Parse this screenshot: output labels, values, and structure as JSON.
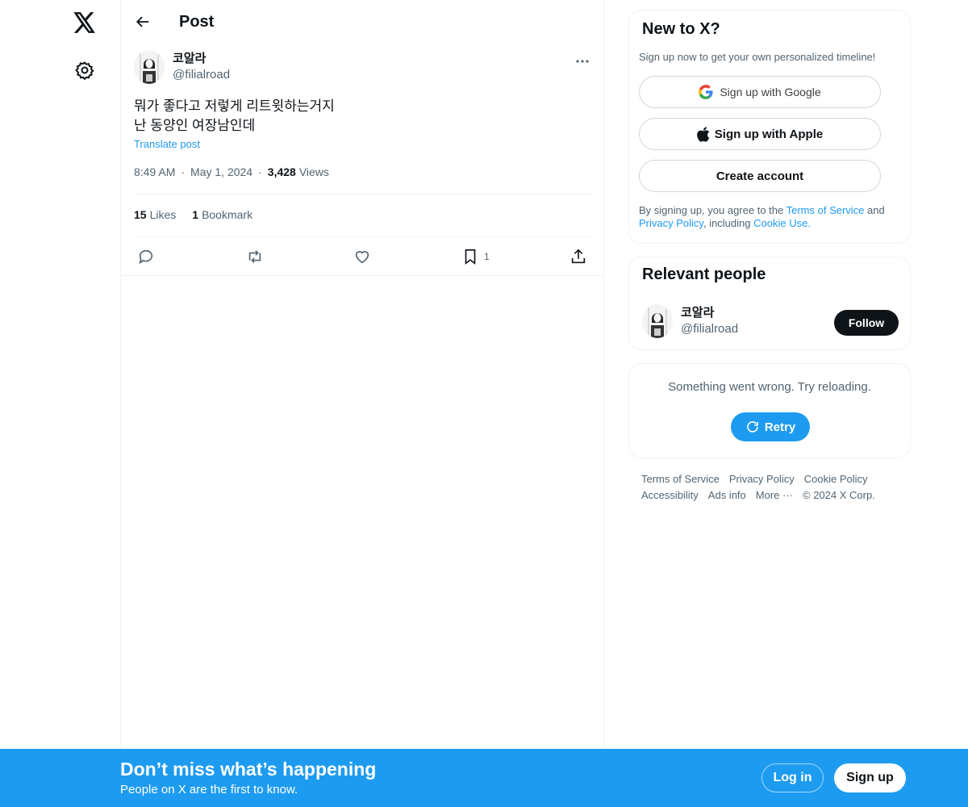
{
  "nav": {
    "logo_icon": "x-logo-icon",
    "settings_icon": "gear-icon"
  },
  "header": {
    "title": "Post"
  },
  "post": {
    "author_name": "코알라",
    "author_handle": "@filialroad",
    "text": "뭐가 좋다고 저렇게 리트윗하는거지\n난 동양인 여장남인데",
    "translate_label": "Translate post",
    "time": "8:49 AM",
    "date": "May 1, 2024",
    "views_count": "3,428",
    "views_label": "Views",
    "likes_count": "15",
    "likes_label": "Likes",
    "bookmarks_count": "1",
    "bookmarks_label": "Bookmark",
    "bookmark_action_count": "1"
  },
  "signup_card": {
    "title": "New to X?",
    "subtitle": "Sign up now to get your own personalized timeline!",
    "google_label": "Sign up with Google",
    "apple_label": "Sign up with Apple",
    "create_label": "Create account",
    "terms_prefix": "By signing up, you agree to the ",
    "terms_link": "Terms of Service",
    "terms_and": " and ",
    "privacy_link": "Privacy Policy",
    "including": ", including ",
    "cookie_link": "Cookie Use."
  },
  "relevant": {
    "title": "Relevant people",
    "name": "코알라",
    "handle": "@filialroad",
    "follow_label": "Follow"
  },
  "error_card": {
    "message": "Something went wrong. Try reloading.",
    "retry_label": "Retry"
  },
  "footer": {
    "terms": "Terms of Service",
    "privacy": "Privacy Policy",
    "cookie": "Cookie Policy",
    "accessibility": "Accessibility",
    "ads": "Ads info",
    "more": "More ···",
    "copyright": "© 2024 X Corp."
  },
  "banner": {
    "title": "Don’t miss what’s happening",
    "subtitle": "People on X are the first to know.",
    "login_label": "Log in",
    "signup_label": "Sign up"
  },
  "colors": {
    "accent": "#1d9bf0",
    "text": "#0f1419",
    "muted": "#536471",
    "border": "#eff3f4"
  }
}
